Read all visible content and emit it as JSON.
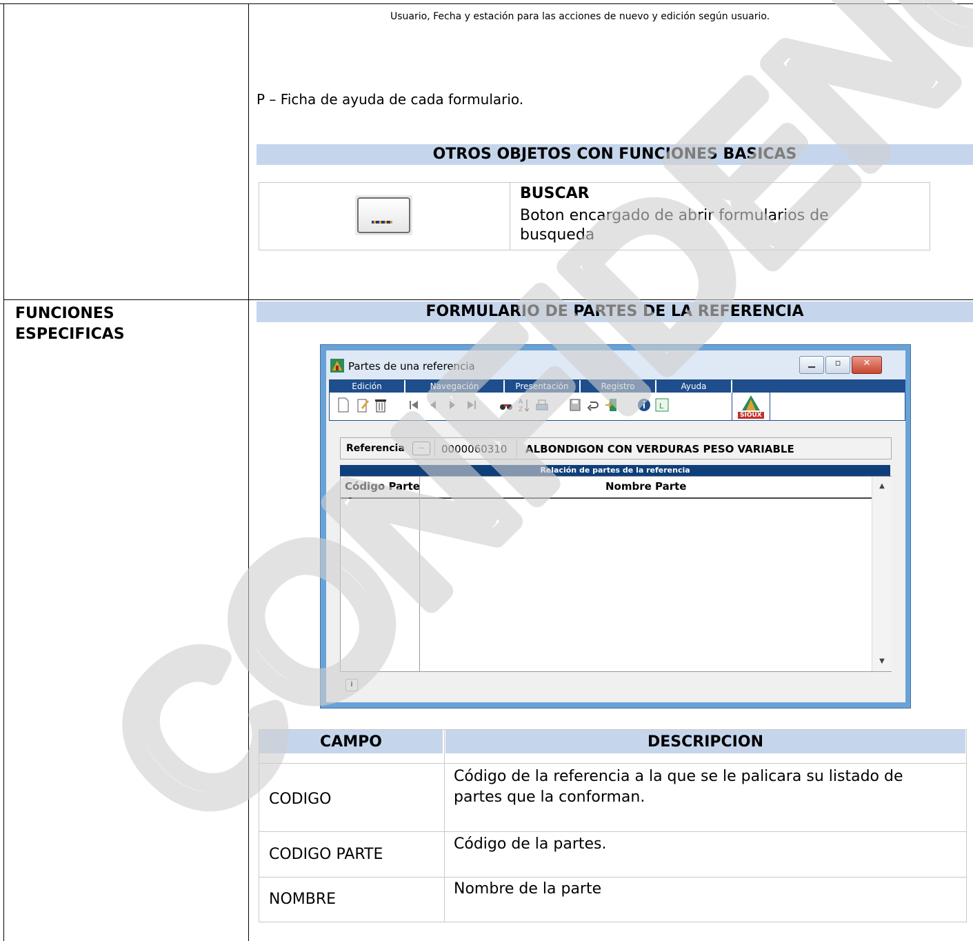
{
  "top_note": "Usuario, Fecha y estación para las acciones de nuevo y edición según usuario.",
  "help_line": "P – Ficha de ayuda de cada formulario.",
  "band_other": "OTROS OBJETOS CON FUNCIONES BASICAS",
  "buscar": {
    "title": "BUSCAR",
    "description": "Boton encargado de abrir formularios de busqueda"
  },
  "section_label": "FUNCIONES ESPECIFICAS",
  "band_form": "FORMULARIO DE PARTES DE LA REFERENCIA",
  "window": {
    "title": "Partes de una referencia",
    "menu": [
      "Edición",
      "Navegación",
      "Presentación",
      "Registro",
      "Ayuda"
    ],
    "logo_text": "SIOUX",
    "ref_label": "Referencia",
    "ref_button": "...",
    "ref_code": "0000060310",
    "ref_name": "ALBONDIGON CON VERDURAS PESO VARIABLE",
    "grid_title": "Relación de partes de la referencia",
    "col_code": "Código Parte",
    "col_name": "Nombre Parte"
  },
  "fields": {
    "header_campo": "CAMPO",
    "header_desc": "DESCRIPCION",
    "rows": [
      {
        "campo": "CODIGO",
        "desc": "Código de la referencia a la que se le palicara su listado de partes que la conforman."
      },
      {
        "campo": "CODIGO PARTE",
        "desc": "Código de la partes."
      },
      {
        "campo": "NOMBRE",
        "desc": "Nombre de la parte"
      }
    ]
  },
  "watermark_text": "CONFIDENCIAL"
}
